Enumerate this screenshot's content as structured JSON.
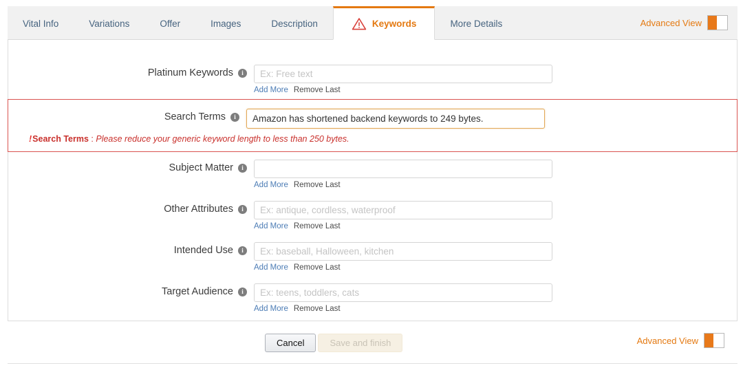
{
  "tabs": [
    {
      "label": "Vital Info",
      "active": false,
      "icon": null
    },
    {
      "label": "Variations",
      "active": false,
      "icon": null
    },
    {
      "label": "Offer",
      "active": false,
      "icon": null
    },
    {
      "label": "Images",
      "active": false,
      "icon": null
    },
    {
      "label": "Description",
      "active": false,
      "icon": null
    },
    {
      "label": "Keywords",
      "active": true,
      "icon": "warning-triangle-icon"
    },
    {
      "label": "More Details",
      "active": false,
      "icon": null
    }
  ],
  "advanced_view": {
    "label": "Advanced View",
    "toggle_state": "on",
    "accent_color": "#e8791a"
  },
  "form": {
    "info_icon_glyph": "i",
    "fields": [
      {
        "label": "Platinum Keywords",
        "value": "",
        "placeholder": "Ex: Free text",
        "add_more": "Add More",
        "remove_last": "Remove Last",
        "focused": false
      },
      {
        "label": "Search Terms",
        "value": "Amazon has shortened backend keywords to 249 bytes.",
        "placeholder": "",
        "add_more": "",
        "remove_last": "",
        "focused": true
      },
      {
        "label": "Subject Matter",
        "value": "",
        "placeholder": "",
        "add_more": "Add More",
        "remove_last": "Remove Last",
        "focused": false
      },
      {
        "label": "Other Attributes",
        "value": "",
        "placeholder": "Ex: antique, cordless, waterproof",
        "add_more": "Add More",
        "remove_last": "Remove Last",
        "focused": false
      },
      {
        "label": "Intended Use",
        "value": "",
        "placeholder": "Ex: baseball, Halloween, kitchen",
        "add_more": "Add More",
        "remove_last": "Remove Last",
        "focused": false
      },
      {
        "label": "Target Audience",
        "value": "",
        "placeholder": "Ex: teens, toddlers, cats",
        "add_more": "Add More",
        "remove_last": "Remove Last",
        "focused": false
      }
    ]
  },
  "error": {
    "marker": "!",
    "field": "Search Terms",
    "separator": " : ",
    "message": "Please reduce your generic keyword length to less than 250 bytes.",
    "color": "#c9302c",
    "border_color": "#d9534f"
  },
  "footer": {
    "cancel_label": "Cancel",
    "save_label": "Save and finish",
    "save_disabled": true
  }
}
